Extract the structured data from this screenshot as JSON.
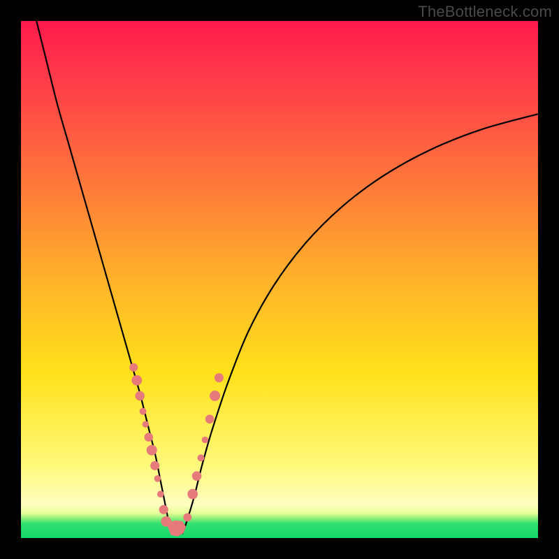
{
  "attribution": "TheBottleneck.com",
  "colors": {
    "gradient_top": "#ff1a4b",
    "gradient_mid1": "#ff7a3a",
    "gradient_mid2": "#ffe11a",
    "gradient_band_pale": "#fffec0",
    "gradient_bottom": "#11d869",
    "curve_stroke": "#000000",
    "marker_fill": "#e77b7b",
    "frame": "#000000"
  },
  "chart_data": {
    "type": "line",
    "title": "",
    "xlabel": "",
    "ylabel": "",
    "xlim": [
      0,
      100
    ],
    "ylim": [
      0,
      100
    ],
    "grid": false,
    "curves": [
      {
        "name": "left-branch",
        "note": "descending arc from top-left to valley",
        "points_xy": [
          [
            3,
            100
          ],
          [
            5,
            92
          ],
          [
            7,
            84
          ],
          [
            9,
            77
          ],
          [
            11,
            70
          ],
          [
            13,
            63
          ],
          [
            15,
            56
          ],
          [
            17,
            49
          ],
          [
            19,
            42
          ],
          [
            21,
            35
          ],
          [
            23,
            28
          ],
          [
            24.5,
            22
          ],
          [
            26,
            16
          ],
          [
            27,
            11
          ],
          [
            28,
            6
          ],
          [
            28.7,
            2.5
          ],
          [
            29.2,
            0.8
          ]
        ]
      },
      {
        "name": "right-branch",
        "note": "ascending arc from valley to upper-right",
        "points_xy": [
          [
            31.2,
            0.8
          ],
          [
            32,
            3
          ],
          [
            33.5,
            8
          ],
          [
            35,
            14
          ],
          [
            37,
            21
          ],
          [
            40,
            30
          ],
          [
            44,
            40
          ],
          [
            49,
            49
          ],
          [
            55,
            57
          ],
          [
            62,
            64
          ],
          [
            70,
            70
          ],
          [
            79,
            75
          ],
          [
            89,
            79
          ],
          [
            100,
            82
          ]
        ]
      }
    ],
    "valley": {
      "bottom_segment_xy": [
        [
          29.2,
          0.5
        ],
        [
          31.2,
          0.5
        ]
      ],
      "markers_left_xy": [
        [
          21.8,
          33
        ],
        [
          22.4,
          30.5
        ],
        [
          23.0,
          27.5
        ],
        [
          23.6,
          24.5
        ],
        [
          24.1,
          22.0
        ],
        [
          24.7,
          19.5
        ],
        [
          25.3,
          17.0
        ],
        [
          25.9,
          14.0
        ],
        [
          26.4,
          11.5
        ],
        [
          27.0,
          8.5
        ],
        [
          27.6,
          5.5
        ],
        [
          28.1,
          3.2
        ]
      ],
      "markers_right_xy": [
        [
          32.2,
          4.0
        ],
        [
          33.2,
          8.5
        ],
        [
          34.0,
          12.0
        ],
        [
          34.8,
          15.5
        ],
        [
          35.6,
          19.0
        ],
        [
          36.5,
          23.0
        ],
        [
          37.5,
          27.5
        ],
        [
          38.3,
          31.0
        ]
      ],
      "blob_poly_xy": [
        [
          28.3,
          2.4
        ],
        [
          29.0,
          0.6
        ],
        [
          30.3,
          0.3
        ],
        [
          31.4,
          0.9
        ],
        [
          31.9,
          2.2
        ],
        [
          31.2,
          3.3
        ],
        [
          29.8,
          3.4
        ],
        [
          28.7,
          3.0
        ]
      ]
    }
  }
}
